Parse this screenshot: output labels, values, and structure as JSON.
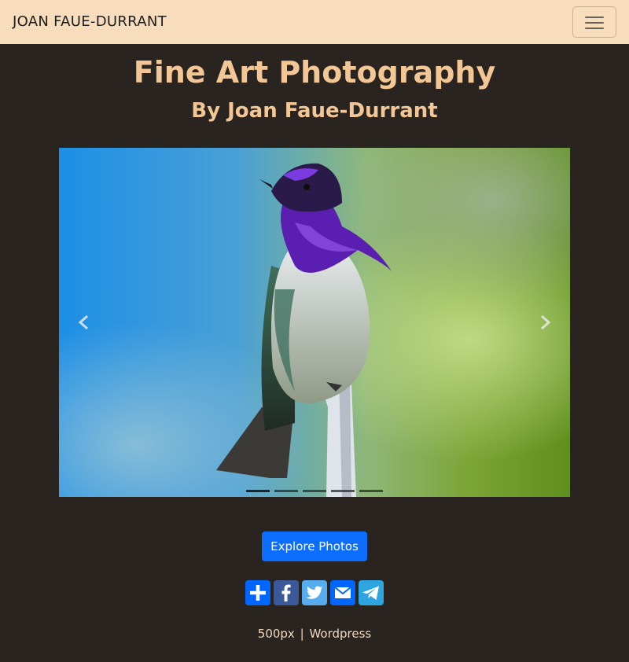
{
  "navbar": {
    "brand": "JOAN FAUE-DURRANT",
    "toggler_icon": "menu-icon"
  },
  "header": {
    "title": "Fine Art Photography",
    "subtitle": "By Joan Faue-Durrant"
  },
  "carousel": {
    "slide_count": 5,
    "active_index": 0,
    "prev_icon": "chevron-left-icon",
    "next_icon": "chevron-right-icon"
  },
  "cta": {
    "explore_label": "Explore Photos"
  },
  "share": {
    "buttons": [
      {
        "icon": "plus-icon",
        "color": "#0166ff"
      },
      {
        "icon": "facebook-icon",
        "color": "#3b5998"
      },
      {
        "icon": "twitter-icon",
        "color": "#55acee"
      },
      {
        "icon": "email-icon",
        "color": "#0166ff"
      },
      {
        "icon": "telegram-icon",
        "color": "#2ca5e0"
      }
    ]
  },
  "footer": {
    "link_500px": "500px",
    "separator": "|",
    "link_wordpress": "Wordpress"
  },
  "colors": {
    "background": "#2a2420",
    "navbar": "#f7ddbb",
    "heading": "#f3c696",
    "primary_button": "#0d6efd"
  }
}
